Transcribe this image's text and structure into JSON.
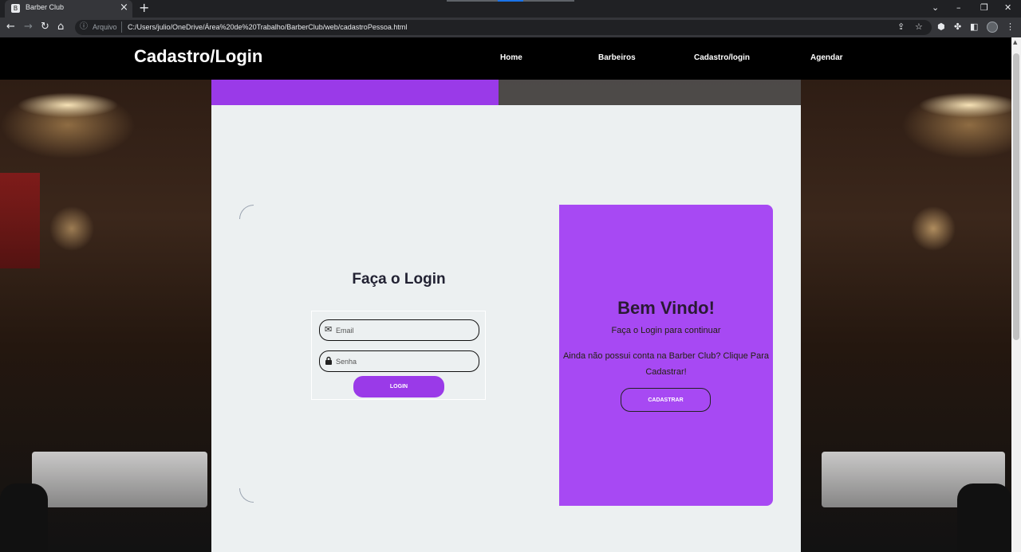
{
  "browser": {
    "tab_title": "Barber Club",
    "tab_favicon": "B",
    "new_tab_glyph": "+",
    "close_glyph": "×",
    "scheme_label": "Arquivo",
    "url": "C:/Users/julio/OneDrive/Área%20de%20Trabalho/BarberClub/web/cadastroPessoa.html"
  },
  "site": {
    "brand": "Cadastro/Login",
    "nav": [
      {
        "label": "Home"
      },
      {
        "label": "Barbeiros"
      },
      {
        "label": "Cadastro/login"
      },
      {
        "label": "Agendar"
      }
    ]
  },
  "login": {
    "title": "Faça o Login",
    "email_placeholder": "Email",
    "password_placeholder": "Senha",
    "button_label": "LOGIN"
  },
  "welcome": {
    "title": "Bem Vindo!",
    "subtitle": "Faça o Login para continuar",
    "text": "Ainda não possui conta na Barber Club? Clique Para Cadastrar!",
    "button_label": "CADASTRAR"
  },
  "colors": {
    "accent": "#9a3ae8",
    "card": "#a749f3",
    "panel": "#ecf0f1",
    "header": "#000000"
  },
  "icons": [
    "envelope-icon",
    "lock-icon",
    "back-icon",
    "forward-icon",
    "reload-icon",
    "home-icon",
    "info-icon",
    "share-icon",
    "star-icon",
    "extension-icon",
    "puzzle-icon",
    "sidebar-icon",
    "menu-icon"
  ]
}
